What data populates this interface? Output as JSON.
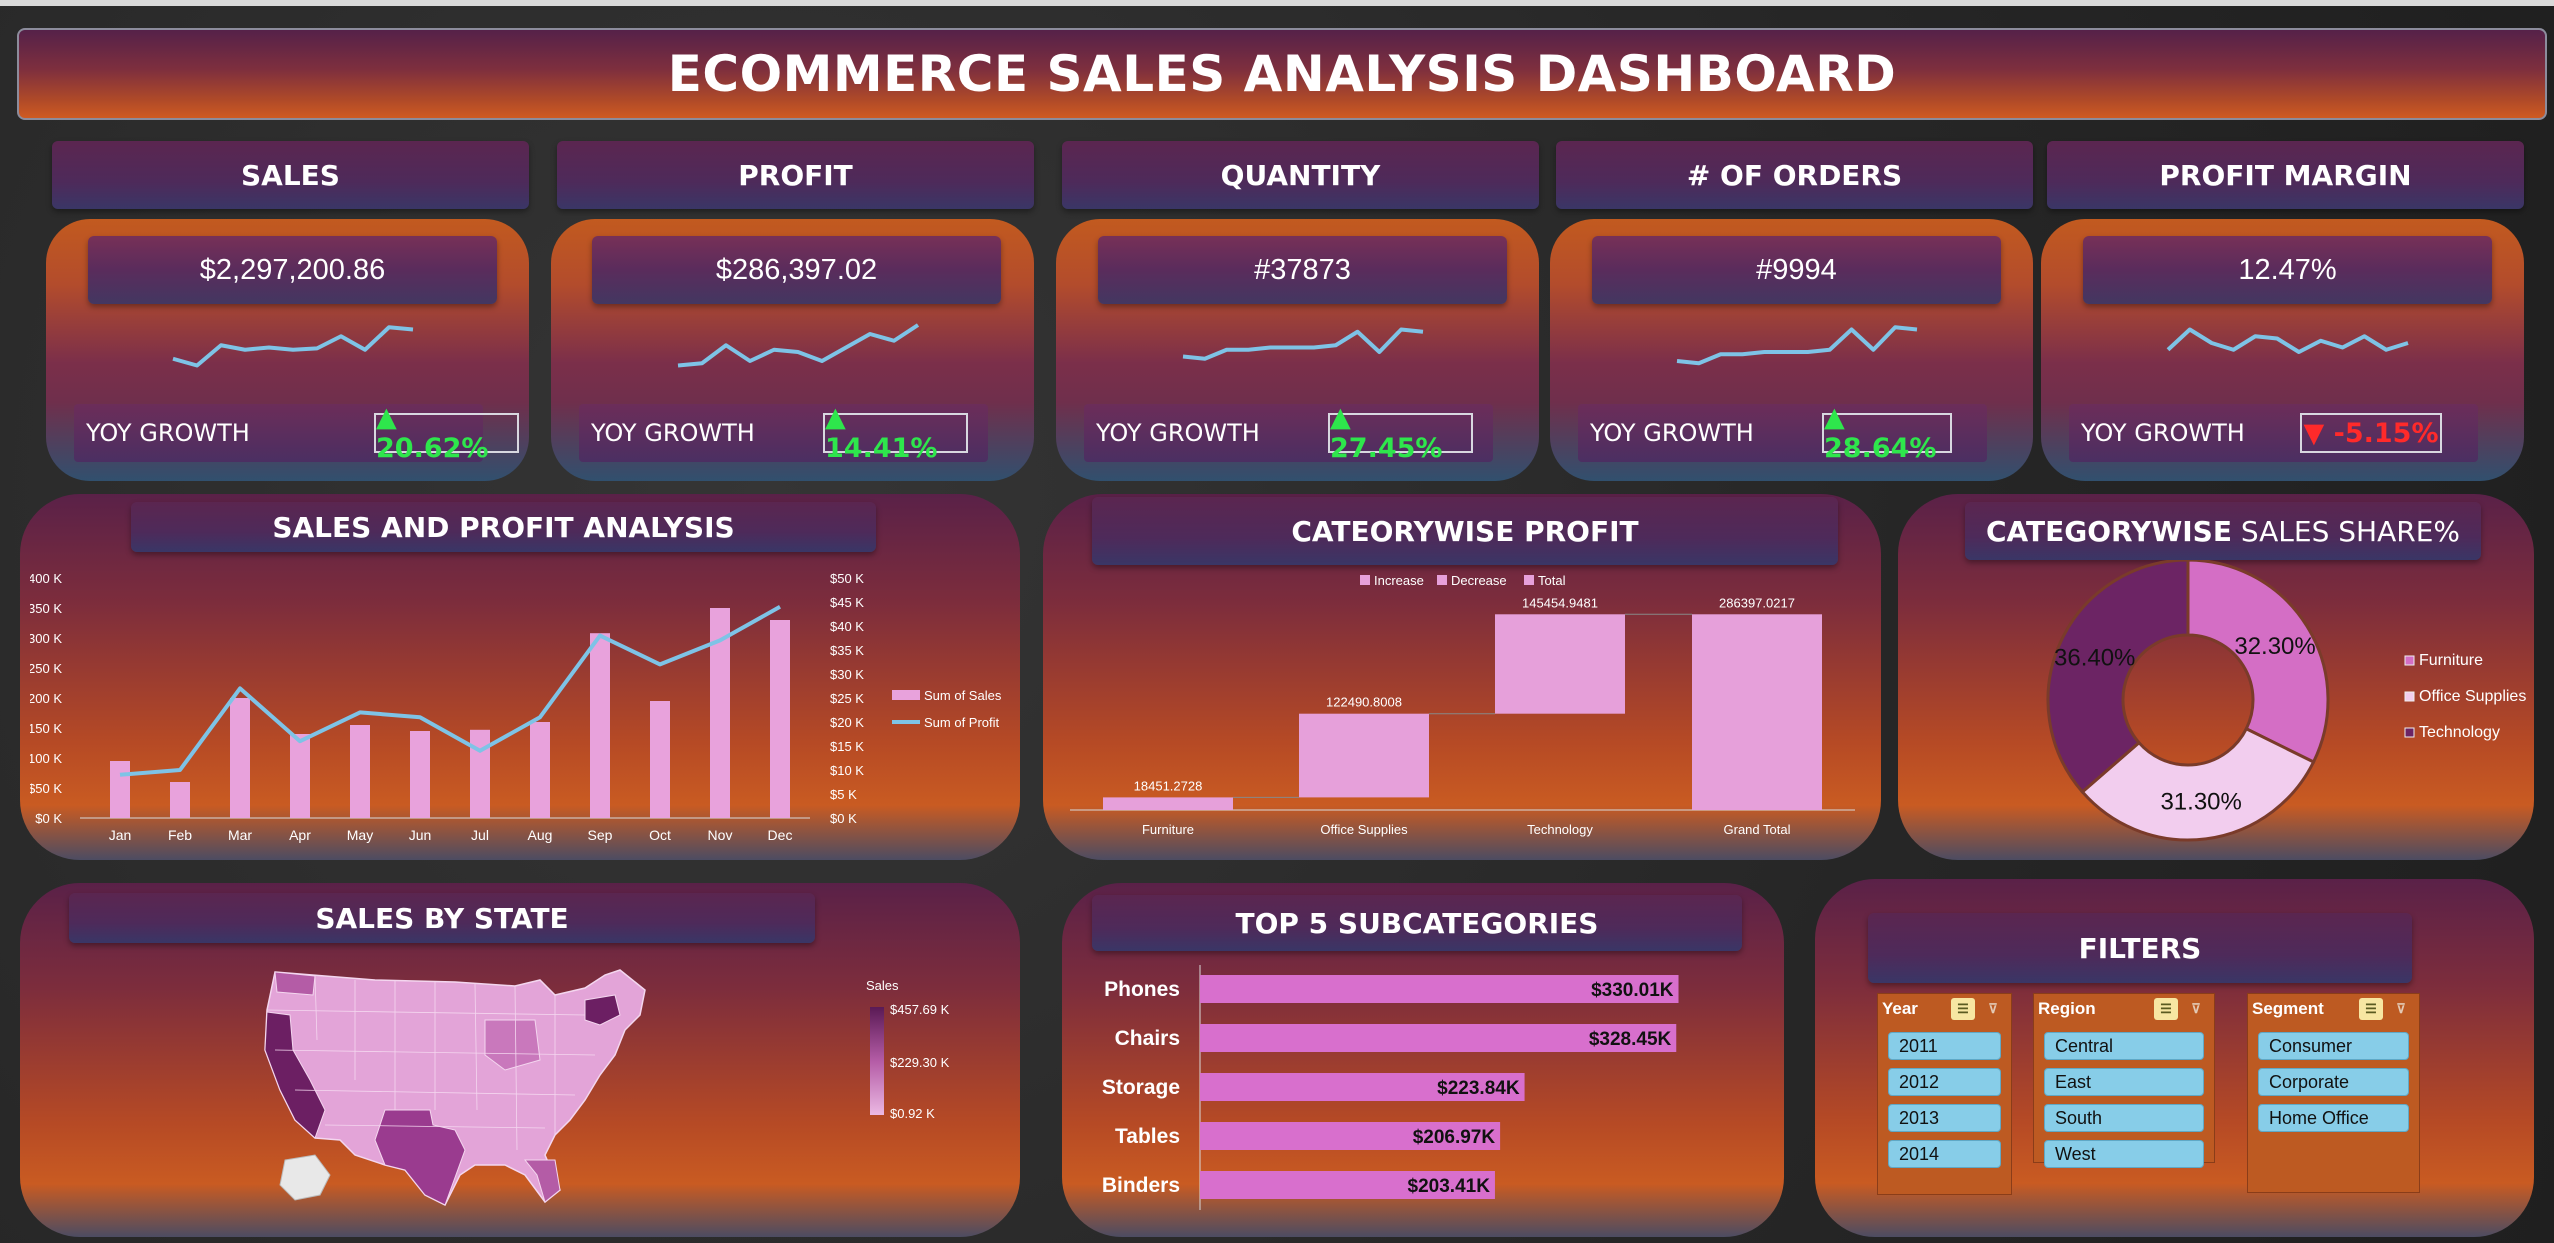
{
  "title": "ECOMMERCE SALES ANALYSIS DASHBOARD",
  "kpis": [
    {
      "label": "SALES",
      "value": "$2,297,200.86",
      "yoy_label": "YOY GROWTH",
      "yoy": "▲ 20.62%",
      "trend": "up",
      "spark": [
        0.25,
        0.1,
        0.55,
        0.45,
        0.5,
        0.45,
        0.48,
        0.75,
        0.45,
        0.95,
        0.9
      ]
    },
    {
      "label": "PROFIT",
      "value": "$286,397.02",
      "yoy_label": "YOY GROWTH",
      "yoy": "▲ 14.41%",
      "trend": "up",
      "spark": [
        0.1,
        0.15,
        0.55,
        0.2,
        0.45,
        0.4,
        0.2,
        0.5,
        0.8,
        0.65,
        1.0
      ]
    },
    {
      "label": "QUANTITY",
      "value": "#37873",
      "yoy_label": "YOY GROWTH",
      "yoy": "▲ 27.45%",
      "trend": "up",
      "spark": [
        0.3,
        0.25,
        0.45,
        0.45,
        0.5,
        0.5,
        0.5,
        0.55,
        0.85,
        0.4,
        0.9,
        0.85
      ]
    },
    {
      "label": "# OF ORDERS",
      "value": "#9994",
      "yoy_label": "YOY GROWTH",
      "yoy": "▲ 28.64%",
      "trend": "up",
      "spark": [
        0.2,
        0.15,
        0.35,
        0.35,
        0.4,
        0.4,
        0.4,
        0.45,
        0.9,
        0.45,
        0.95,
        0.9
      ]
    },
    {
      "label": "PROFIT MARGIN",
      "value": "12.47%",
      "yoy_label": "YOY GROWTH",
      "yoy": "▼ -5.15%",
      "trend": "down",
      "spark": [
        0.45,
        0.9,
        0.6,
        0.45,
        0.75,
        0.7,
        0.4,
        0.65,
        0.5,
        0.75,
        0.45,
        0.6
      ]
    }
  ],
  "sales_profit": {
    "title": "SALES AND PROFIT ANALYSIS",
    "chart_data": {
      "type": "bar",
      "categories": [
        "Jan",
        "Feb",
        "Mar",
        "Apr",
        "May",
        "Jun",
        "Jul",
        "Aug",
        "Sep",
        "Oct",
        "Nov",
        "Dec"
      ],
      "series": [
        {
          "name": "Sum of Sales",
          "axis": "left",
          "values": [
            95000,
            60000,
            200000,
            140000,
            155000,
            145000,
            147000,
            160000,
            308000,
            195000,
            350000,
            330000
          ]
        },
        {
          "name": "Sum of Profit",
          "axis": "right",
          "values": [
            9000,
            10000,
            27000,
            16000,
            22000,
            21000,
            14000,
            21000,
            38000,
            32000,
            37000,
            44000
          ]
        }
      ],
      "y_left": {
        "min": 0,
        "max": 400000,
        "ticks": [
          "$0 K",
          "$50 K",
          "$100 K",
          "$150 K",
          "$200 K",
          "$250 K",
          "$300 K",
          "$350 K",
          "$400 K"
        ]
      },
      "y_right": {
        "min": 0,
        "max": 50000,
        "ticks": [
          "$0 K",
          "$5 K",
          "$10 K",
          "$15 K",
          "$20 K",
          "$25 K",
          "$30 K",
          "$35 K",
          "$40 K",
          "$45 K",
          "$50 K"
        ]
      },
      "legend": "right",
      "colors": {
        "bar": "#e8a2dc",
        "line": "#7ec3e6"
      }
    }
  },
  "category_profit": {
    "title": "CATEORYWISE PROFIT",
    "chart_data": {
      "type": "bar",
      "subtype": "waterfall",
      "categories": [
        "Furniture",
        "Office Supplies",
        "Technology",
        "Grand Total"
      ],
      "values": [
        18451.2728,
        122490.8008,
        145454.9481,
        286397.0217
      ],
      "labels": [
        "18451.2728",
        "122490.8008",
        "145454.9481",
        "286397.0217"
      ],
      "legend": [
        "Increase",
        "Decrease",
        "Total"
      ],
      "ylim": [
        0,
        300000
      ],
      "colors": {
        "bar": "#e6a0da"
      }
    }
  },
  "category_share": {
    "title_bold": "CATEGORYWISE",
    "title_rest": " SALES SHARE%",
    "chart_data": {
      "type": "pie",
      "categories": [
        "Furniture",
        "Office Supplies",
        "Technology"
      ],
      "values": [
        32.3,
        31.3,
        36.4
      ],
      "labels": [
        "32.30%",
        "31.30%",
        "36.40%"
      ],
      "colors": [
        "#d46ec5",
        "#f2cdee",
        "#6c2464"
      ]
    }
  },
  "sales_by_state": {
    "title": "SALES BY STATE",
    "legend_title": "Sales",
    "legend_max": "$457.69 K",
    "legend_mid": "$229.30 K",
    "legend_min": "$0.92 K"
  },
  "top5": {
    "title": "TOP 5 SUBCATEGORIES",
    "chart_data": {
      "type": "bar",
      "orientation": "horizontal",
      "categories": [
        "Phones",
        "Chairs",
        "Storage",
        "Tables",
        "Binders"
      ],
      "values": [
        330010,
        328450,
        223840,
        206970,
        203410
      ],
      "labels": [
        "$330.01K",
        "$328.45K",
        "$223.84K",
        "$206.97K",
        "$203.41K"
      ],
      "colors": {
        "bar": "#d86fcd"
      }
    }
  },
  "filters": {
    "title": "FILTERS",
    "groups": [
      {
        "name": "Year",
        "items": [
          "2011",
          "2012",
          "2013",
          "2014"
        ]
      },
      {
        "name": "Region",
        "items": [
          "Central",
          "East",
          "South",
          "West"
        ]
      },
      {
        "name": "Segment",
        "items": [
          "Consumer",
          "Corporate",
          "Home Office"
        ]
      }
    ]
  }
}
